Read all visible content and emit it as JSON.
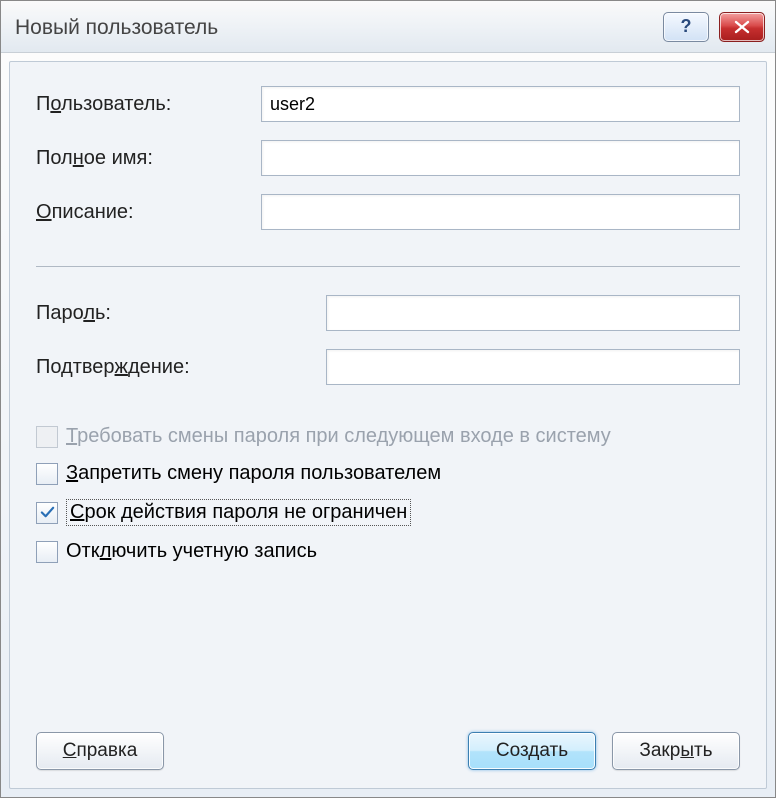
{
  "window": {
    "title": "Новый пользователь"
  },
  "form": {
    "user_label_pre": "П",
    "user_label_u": "о",
    "user_label_post": "льзователь:",
    "user_value": "user2",
    "fullname_label_pre": "Пол",
    "fullname_label_u": "н",
    "fullname_label_post": "ое имя:",
    "fullname_value": "",
    "desc_label_pre": "",
    "desc_label_u": "О",
    "desc_label_post": "писание:",
    "desc_value": "",
    "password_label_pre": "Паро",
    "password_label_u": "л",
    "password_label_post": "ь:",
    "password_value": "",
    "confirm_label_pre": "Подтвер",
    "confirm_label_u": "ж",
    "confirm_label_post": "дение:",
    "confirm_value": ""
  },
  "checks": {
    "require_change_pre": "",
    "require_change_u": "Т",
    "require_change_post": "ребовать смены пароля при следующем входе в систему",
    "require_change_checked": false,
    "require_change_enabled": false,
    "no_change_pre": "",
    "no_change_u": "З",
    "no_change_post": "апретить смену пароля пользователем",
    "no_change_checked": false,
    "never_expire_pre": "",
    "never_expire_u": "С",
    "never_expire_post": "рок действия пароля не ограничен",
    "never_expire_checked": true,
    "disable_pre": "Отк",
    "disable_u": "л",
    "disable_post": "ючить учетную запись",
    "disable_checked": false
  },
  "buttons": {
    "help_pre": "",
    "help_u": "С",
    "help_post": "правка",
    "create": "Создать",
    "close_pre": "Закр",
    "close_u": "ы",
    "close_post": "ть"
  }
}
